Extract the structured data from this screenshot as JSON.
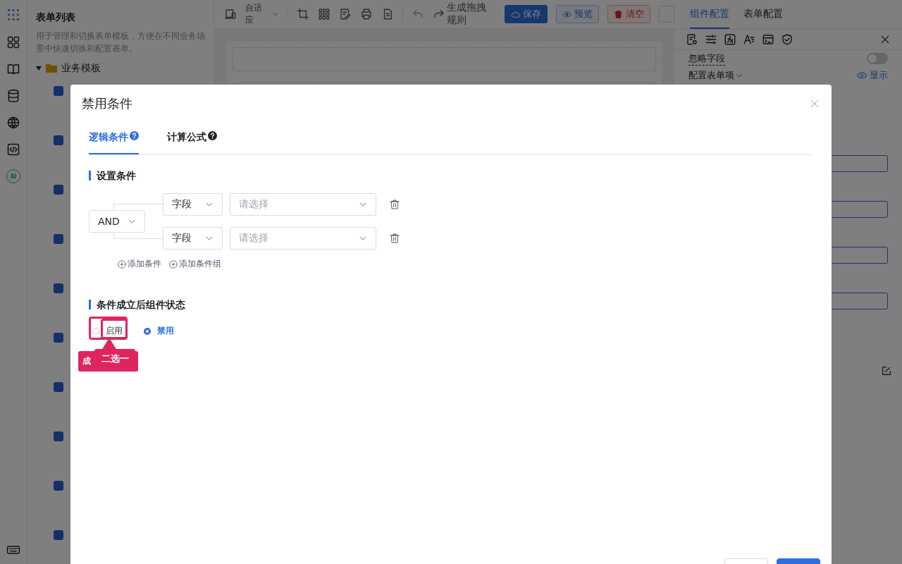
{
  "icon_rail": {
    "items": [
      {
        "kind": "apps"
      },
      {
        "kind": "grid"
      },
      {
        "kind": "book"
      },
      {
        "kind": "database"
      },
      {
        "kind": "globe"
      },
      {
        "kind": "code"
      },
      {
        "kind": "ai",
        "label": "AI"
      },
      {
        "kind": "keyboard"
      }
    ]
  },
  "sidebar": {
    "title": "表单列表",
    "description": "用于管理和切换表单模板，方便在不同业务场景中快速切换和配置表单。",
    "folder": {
      "label": "业务模板",
      "expanded": true,
      "children": [
        {
          "kind": "form"
        },
        {
          "kind": "form"
        },
        {
          "kind": "form"
        },
        {
          "kind": "form"
        },
        {
          "kind": "form"
        },
        {
          "kind": "form"
        },
        {
          "kind": "form"
        },
        {
          "kind": "form"
        },
        {
          "kind": "form"
        },
        {
          "kind": "form"
        }
      ]
    }
  },
  "toolbar": {
    "device_select": "自适应",
    "rule_action": "生成拖拽规则",
    "buttons": [
      {
        "label": "保存",
        "kind": "primary"
      },
      {
        "label": "预览",
        "kind": "outline"
      },
      {
        "label": "清空",
        "kind": "danger"
      }
    ]
  },
  "right_panel": {
    "tabs": [
      {
        "label": "组件配置",
        "selected": true
      },
      {
        "label": "表单配置",
        "selected": false
      }
    ],
    "ignore_field": {
      "label": "忽略字段",
      "on": false
    },
    "form_items": {
      "label": "配置表单项",
      "action": "显示"
    }
  },
  "dialog": {
    "title": "禁用条件",
    "tabs": [
      {
        "label": "逻辑条件",
        "selected": true
      },
      {
        "label": "计算公式",
        "selected": false
      }
    ],
    "condition_section": "设置条件",
    "operator": "AND",
    "rows": [
      {
        "field": "字段",
        "placeholder": "请选择"
      },
      {
        "field": "字段",
        "placeholder": "请选择"
      }
    ],
    "add_links": [
      "添加条件",
      "添加条件组"
    ],
    "state_section": "条件成立后组件状态",
    "radios": [
      {
        "label": "启用",
        "selected": false
      },
      {
        "label": "禁用",
        "selected": true
      }
    ]
  },
  "annotation": {
    "label": "二选一",
    "hidden_label": "成"
  }
}
